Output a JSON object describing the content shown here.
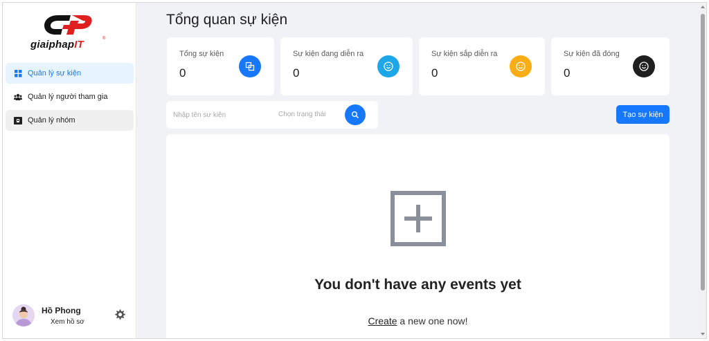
{
  "brand": {
    "logo_text_main": "giaiphap",
    "logo_text_accent": "IT",
    "logo_reg": "®"
  },
  "sidebar": {
    "items": [
      {
        "label": "Quản lý sự kiện",
        "icon": "grid-icon",
        "active": true
      },
      {
        "label": "Quản lý người tham gia",
        "icon": "users-icon",
        "active": false
      },
      {
        "label": "Quản lý nhóm",
        "icon": "group-card-icon",
        "active": false
      }
    ],
    "user": {
      "name": "Hồ Phong",
      "profile_link": "Xem hồ sơ"
    }
  },
  "main": {
    "title": "Tổng quan sự kiện",
    "stats": [
      {
        "label": "Tổng sự kiện",
        "value": "0",
        "icon": "copy-icon",
        "color": "#1677ff"
      },
      {
        "label": "Sự kiện đang diễn ra",
        "value": "0",
        "icon": "smile-icon",
        "color": "#1ea7e8"
      },
      {
        "label": "Sự kiện sắp diễn ra",
        "value": "0",
        "icon": "smile-icon",
        "color": "#faad14"
      },
      {
        "label": "Sự kiện đã đóng",
        "value": "0",
        "icon": "smile-icon",
        "color": "#1f1f1f"
      }
    ],
    "search": {
      "placeholder": "Nhập tên sự kiện",
      "status_placeholder": "Chọn trạng thái"
    },
    "create_button": "Tạo sự kiện",
    "empty": {
      "title": "You don't have any events yet",
      "link": "Create",
      "suffix": " a new one now!"
    }
  },
  "colors": {
    "accent": "#1677ff",
    "background": "#f0f2f5"
  }
}
